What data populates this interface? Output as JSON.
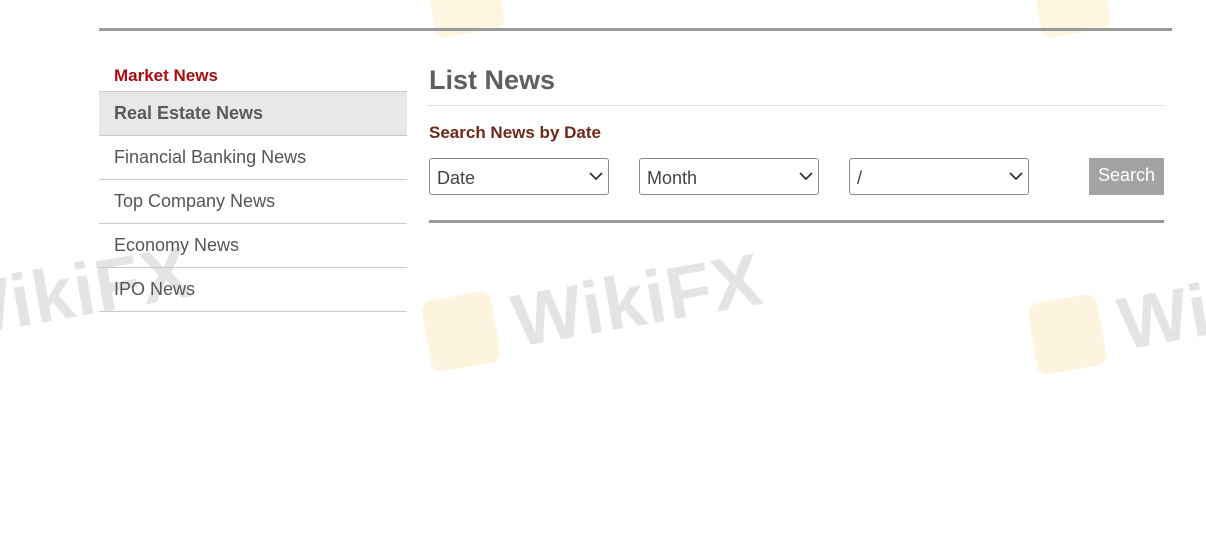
{
  "sidebar": {
    "heading": "Market News",
    "items": [
      {
        "label": "Real Estate News",
        "active": true
      },
      {
        "label": "Financial Banking News",
        "active": false
      },
      {
        "label": "Top Company News",
        "active": false
      },
      {
        "label": "Economy News",
        "active": false
      },
      {
        "label": "IPO News",
        "active": false
      }
    ]
  },
  "main": {
    "title": "List News",
    "search_heading": "Search News by Date",
    "selects": {
      "date": "Date",
      "month": "Month",
      "year": "/"
    },
    "search_label": "Search"
  },
  "watermark": {
    "text": "WikiFX"
  },
  "colors": {
    "accent_red": "#a30f12",
    "heading_brown": "#6b2a1a",
    "button_gray": "#a3a3a3",
    "rule_gray": "#9a9a9a",
    "active_bg": "#e8e8e8"
  },
  "icons": {
    "select_arrow": "chevron-down-icon",
    "watermark_logo": "wikifx-logo-icon"
  }
}
